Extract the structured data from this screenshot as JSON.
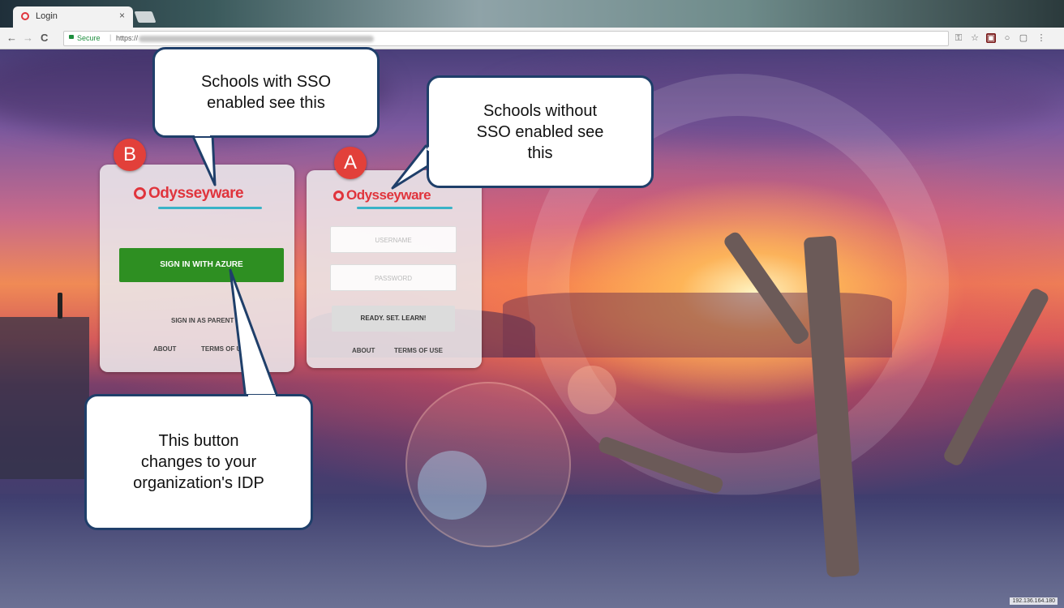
{
  "browser": {
    "tab_title": "Login",
    "tab_close": "×",
    "back": "←",
    "forward": "→",
    "reload": "C",
    "secure_label": "Secure",
    "url_prefix": "https://",
    "toolbar_icons": [
      "key-icon",
      "star-icon",
      "extension-icon",
      "circle-icon",
      "square-icon",
      "menu-icon"
    ]
  },
  "card_sso": {
    "badge": "B",
    "logo_text": "Odysseyware",
    "sign_in_button": "SIGN IN WITH AZURE",
    "parent_link": "SIGN IN AS PARENT",
    "about_link": "ABOUT",
    "terms_link": "TERMS OF USE"
  },
  "card_standard": {
    "badge": "A",
    "logo_text": "Odysseyware",
    "username_placeholder": "USERNAME",
    "password_placeholder": "PASSWORD",
    "submit_button": "READY. SET. LEARN!",
    "about_link": "ABOUT",
    "terms_link": "TERMS OF USE"
  },
  "callouts": {
    "sso": "Schools with SSO\nenabled see  this",
    "no_sso": "Schools without\nSSO enabled see\nthis",
    "idp": "This button\nchanges to your\norganization's IDP"
  },
  "footer": {
    "ip": "192.136.164.180"
  },
  "colors": {
    "brand_red": "#e0343c",
    "azure_green": "#2e8f22",
    "callout_border": "#1f3f6a",
    "badge_red": "#e2403a"
  }
}
